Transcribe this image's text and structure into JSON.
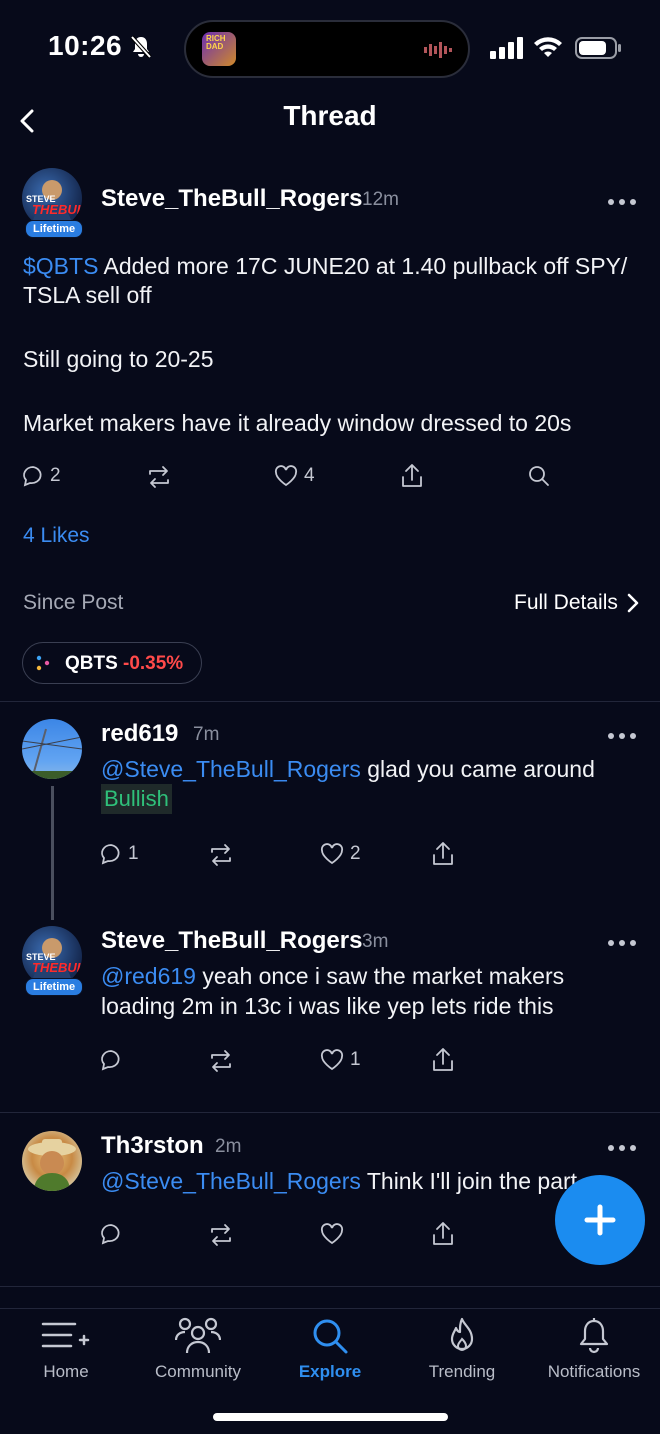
{
  "status": {
    "time": "10:26",
    "island_art_text": "RICH DAD"
  },
  "header": {
    "title": "Thread"
  },
  "post": {
    "author": "Steve_TheBull_Rogers",
    "time": "12m",
    "badge": "Lifetime",
    "ticker_link": "$QBTS",
    "line1_rest": " Added more 17C JUNE20 at 1.40 pullback off SPY/",
    "line2": "TSLA sell off",
    "line3": "Still going to 20-25",
    "line4": "Market makers have it already window dressed to 20s",
    "comments": "2",
    "likes_count": "4",
    "likes_label": "4 Likes",
    "since_post": "Since Post",
    "full_details": "Full Details",
    "chip_symbol": "QBTS",
    "chip_change": "-0.35%"
  },
  "replies": [
    {
      "author": "red619",
      "time": "7m",
      "mention": "@Steve_TheBull_Rogers",
      "text": " glad you came around",
      "sentiment": "Bullish",
      "comments": "1",
      "likes": "2"
    },
    {
      "author": "Steve_TheBull_Rogers",
      "time": "3m",
      "badge": "Lifetime",
      "mention": "@red619",
      "text": " yeah once i saw the market makers",
      "text2": "loading 2m in 13c i was like yep lets ride this",
      "likes": "1"
    },
    {
      "author": "Th3rston",
      "time": "2m",
      "mention": "@Steve_TheBull_Rogers",
      "text": " Think I'll join the part"
    }
  ],
  "tabs": [
    {
      "label": "Home",
      "icon": "home-list-icon"
    },
    {
      "label": "Community",
      "icon": "community-icon"
    },
    {
      "label": "Explore",
      "icon": "search-icon"
    },
    {
      "label": "Trending",
      "icon": "flame-icon"
    },
    {
      "label": "Notifications",
      "icon": "bell-icon"
    }
  ],
  "colors": {
    "accent": "#2f8ff0",
    "negative": "#ff4a4a",
    "bullish": "#2fc07a",
    "background": "#070a1a"
  }
}
